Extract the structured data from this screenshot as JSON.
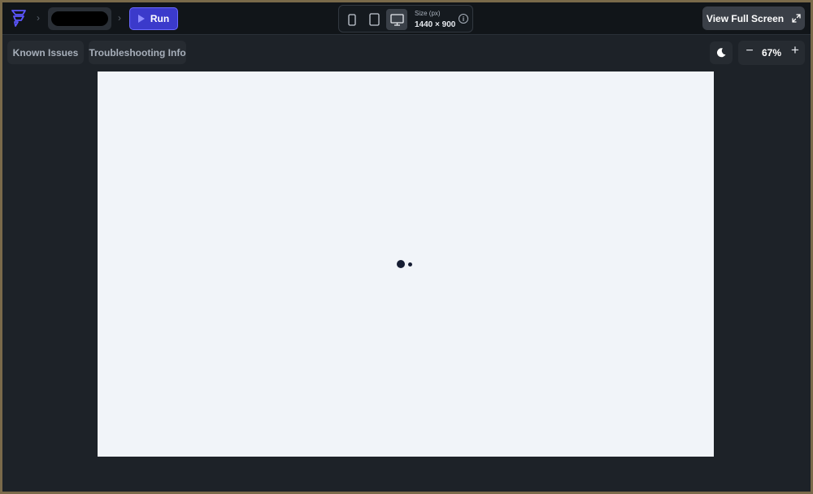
{
  "toolbar": {
    "run_label": "Run",
    "size_label": "Size (px)",
    "size_value": "1440 × 900",
    "fullscreen_label": "View Full Screen",
    "known_issues_label": "Known Issues",
    "troubleshooting_label": "Troubleshooting Info",
    "zoom_value": "67%",
    "zoom_minus": "−",
    "zoom_plus": "+",
    "info_glyph": "i",
    "active_device": "desktop"
  },
  "icons": [
    "logo-icon",
    "chevron-right-icon",
    "play-icon",
    "phone-icon",
    "tablet-icon",
    "desktop-icon",
    "info-icon",
    "expand-arrow-icon",
    "moon-icon"
  ],
  "colors": {
    "background": "#1d2228",
    "topbar": "#111519",
    "run_button": "#3b3acb",
    "canvas": "#f1f4f9",
    "loader_dots": "#161d33"
  }
}
